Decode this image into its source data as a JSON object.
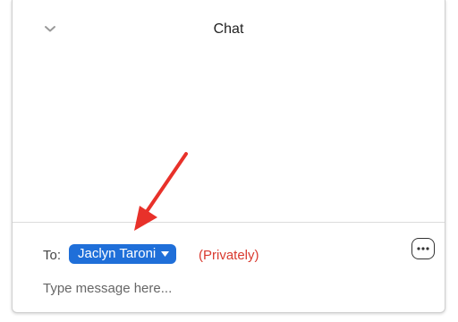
{
  "header": {
    "title": "Chat",
    "collapse_icon": "chevron-down-icon"
  },
  "composer": {
    "to_label": "To:",
    "recipient": "Jaclyn Taroni",
    "recipient_dropdown_icon": "caret-down-icon",
    "privacy_note": "(Privately)",
    "more_options_icon": "ellipsis-icon",
    "message_placeholder": "Type message here..."
  },
  "annotation": {
    "arrow_color": "#e8312a"
  },
  "colors": {
    "recipient_bg": "#1f6fd9",
    "privately_text": "#d93a2f"
  }
}
